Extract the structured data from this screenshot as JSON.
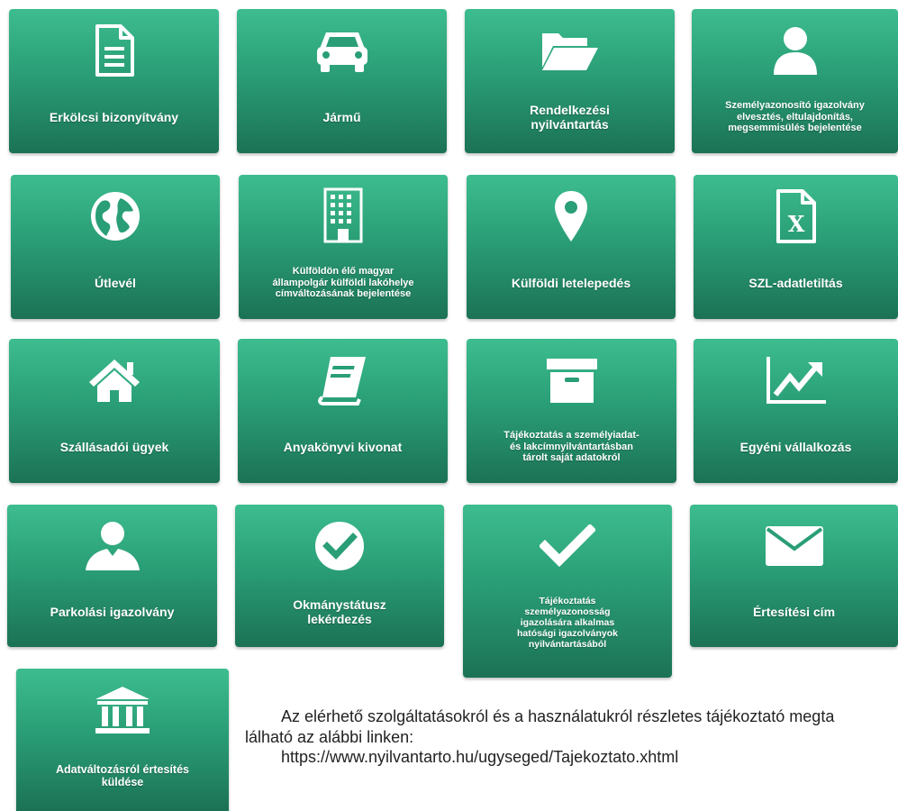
{
  "tiles": [
    {
      "label": "Erkölcsi bizonyítvány",
      "icon": "document-icon"
    },
    {
      "label": "Jármű",
      "icon": "car-icon"
    },
    {
      "label": "Rendelkezési\nnyilvántartás",
      "icon": "folder-open-icon"
    },
    {
      "label": "Személyazonosító igazolvány\nelvesztés, eltulajdonítás,\nmegsemmisülés bejelentése",
      "icon": "user-icon"
    },
    {
      "label": "Útlevél",
      "icon": "globe-icon"
    },
    {
      "label": "Külföldön élő magyar\nállampolgár külföldi lakóhelye\ncímváltozásának bejelentése",
      "icon": "building-icon"
    },
    {
      "label": "Külföldi letelepedés",
      "icon": "map-marker-icon"
    },
    {
      "label": "SZL-adatletiltás",
      "icon": "excel-file-icon"
    },
    {
      "label": "Szállásadói ügyek",
      "icon": "home-icon"
    },
    {
      "label": "Anyakönyvi kivonat",
      "icon": "book-icon"
    },
    {
      "label": "Tájékoztatás a személyiadat-\nés lakcímnyilvántartásban\ntárolt saját adatokról",
      "icon": "archive-box-icon"
    },
    {
      "label": "Egyéni vállalkozás",
      "icon": "line-chart-icon"
    },
    {
      "label": "Parkolási igazolvány",
      "icon": "person-icon"
    },
    {
      "label": "Okmánystátusz\nlekérdezés",
      "icon": "check-circle-icon"
    },
    {
      "label": "Tájékoztatás\nszemélyazonosság\nigazolására alkalmas\nhatósági igazolványok\nnyilvántartásából",
      "icon": "checkmark-icon"
    },
    {
      "label": "Értesítési cím",
      "icon": "envelope-icon"
    },
    {
      "label": "Adatváltozásról értesítés\nküldése",
      "icon": "bank-building-icon"
    }
  ],
  "info": {
    "line1": "Az elérhető szolgáltatásokról és a használatukról részletes tájékoztató megta",
    "line2": "lálható az alábbi linken:",
    "link": "https://www.nyilvantarto.hu/ugyseged/Tajekoztato.xhtml"
  },
  "colors": {
    "tile_top": "#3dbd8f",
    "tile_bottom": "#1b7254",
    "text": "#222222"
  }
}
